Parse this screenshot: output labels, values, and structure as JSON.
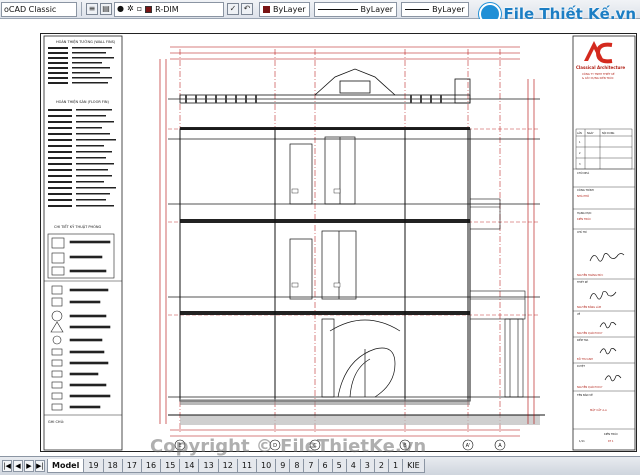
{
  "toolbar": {
    "workspace": "oCAD Classic",
    "layer_name": "R-DIM",
    "color_label": "ByLayer",
    "linetype_label": "ByLayer",
    "lineweight_label": "ByLayer",
    "plot_style_label": "ByLayer",
    "layer_color": "#7a1414"
  },
  "watermark": {
    "text": "File Thiết Kế.vn",
    "bottom_text": "Copyright © FileThietKe.vn"
  },
  "title_block": {
    "company_name": "Classical Architecture",
    "company_line_1": "CÔNG TY TNHH THIẾT KẾ",
    "company_line_2": "& XÂY DỰNG KIẾN TRÚC",
    "rev_headers": [
      "LẦN",
      "NGÀY",
      "NỘI DUNG"
    ],
    "rev_rows": [
      "1",
      "2",
      "3"
    ],
    "fields": [
      {
        "label": "CHỦ NHÀ",
        "value": ""
      },
      {
        "label": "CÔNG TRÌNH",
        "value": "NHÀ PHỐ"
      },
      {
        "label": "HẠNG MỤC",
        "value": "KIẾN TRÚC"
      }
    ],
    "signers": [
      {
        "label": "CHỦ TRÌ",
        "name": "NGUYỄN HOÀNG ĐỨC"
      },
      {
        "label": "THIẾT KẾ",
        "name": "NGUYỄN ĐĂNG LÂM"
      },
      {
        "label": "VẼ",
        "name": "NGUYỄN QUÁCH DUY"
      },
      {
        "label": "KIỂM TRA",
        "name": "ĐỖ THU LINH"
      },
      {
        "label": "DUYỆT",
        "name": "NGUYỄN QUÁCH DUY"
      }
    ],
    "drawing_label": "TÊN BẢN VẼ",
    "drawing_title": "MẶT CẮT A-A",
    "sheet_label": "KIẾN TRÚC",
    "sheet_number": "KT 1",
    "sheet_total": "1/11"
  },
  "legend": {
    "section_1": "HOÀN THIỆN TƯỜNG (WALL FINS)",
    "section_2": "HOÀN THIỆN SÀN (FLOOR FIN)",
    "section_3": "CHI TIẾT KỸ THUẬT PHÒNG",
    "note_label": "GHI CHÚ:"
  },
  "grid_labels": [
    "E",
    "D",
    "C",
    "B",
    "A'",
    "A"
  ],
  "tabs": [
    "Model",
    "19",
    "18",
    "17",
    "16",
    "15",
    "14",
    "13",
    "12",
    "11",
    "10",
    "9",
    "8",
    "7",
    "6",
    "5",
    "4",
    "3",
    "2",
    "1",
    "KIE"
  ],
  "active_tab": "Model"
}
